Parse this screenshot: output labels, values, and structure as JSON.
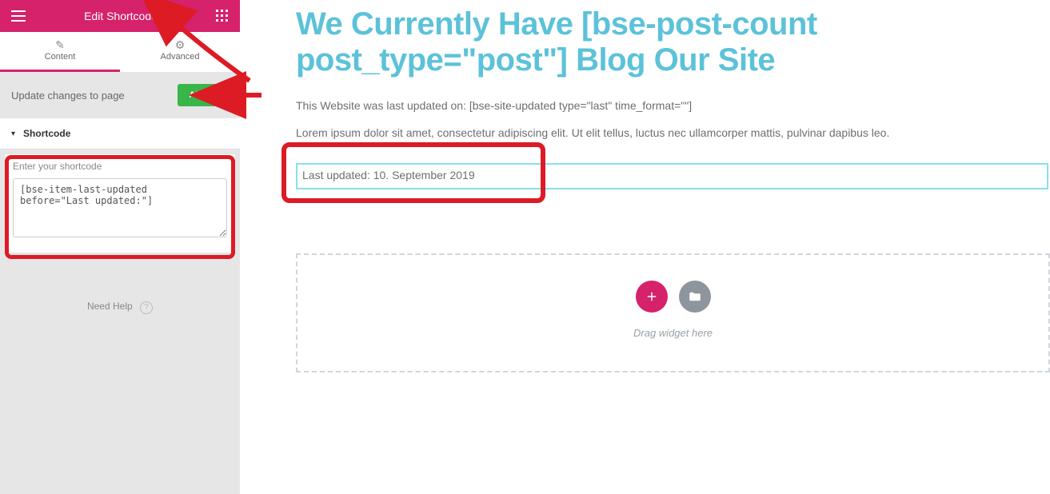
{
  "header": {
    "title": "Edit Shortcode"
  },
  "tabs": {
    "content": "Content",
    "advanced": "Advanced"
  },
  "update": {
    "text": "Update changes to page",
    "apply": "APPLY"
  },
  "section": {
    "title": "Shortcode"
  },
  "shortcode": {
    "label": "Enter your shortcode",
    "value": "[bse-item-last-updated before=\"Last updated:\"]"
  },
  "help": {
    "label": "Need Help"
  },
  "main": {
    "heading": "We Currently Have [bse-post-count post_type=\"post\"] Blog Our Site",
    "meta1": "This Website was last updated on: [bse-site-updated type=\"last\" time_format=\"\"]",
    "meta2": "Lorem ipsum dolor sit amet, consectetur adipiscing elit. Ut elit tellus, luctus nec ullamcorper mattis, pulvinar dapibus leo.",
    "selected_output": "Last updated: 10. September 2019"
  },
  "dropzone": {
    "hint": "Drag widget here"
  }
}
